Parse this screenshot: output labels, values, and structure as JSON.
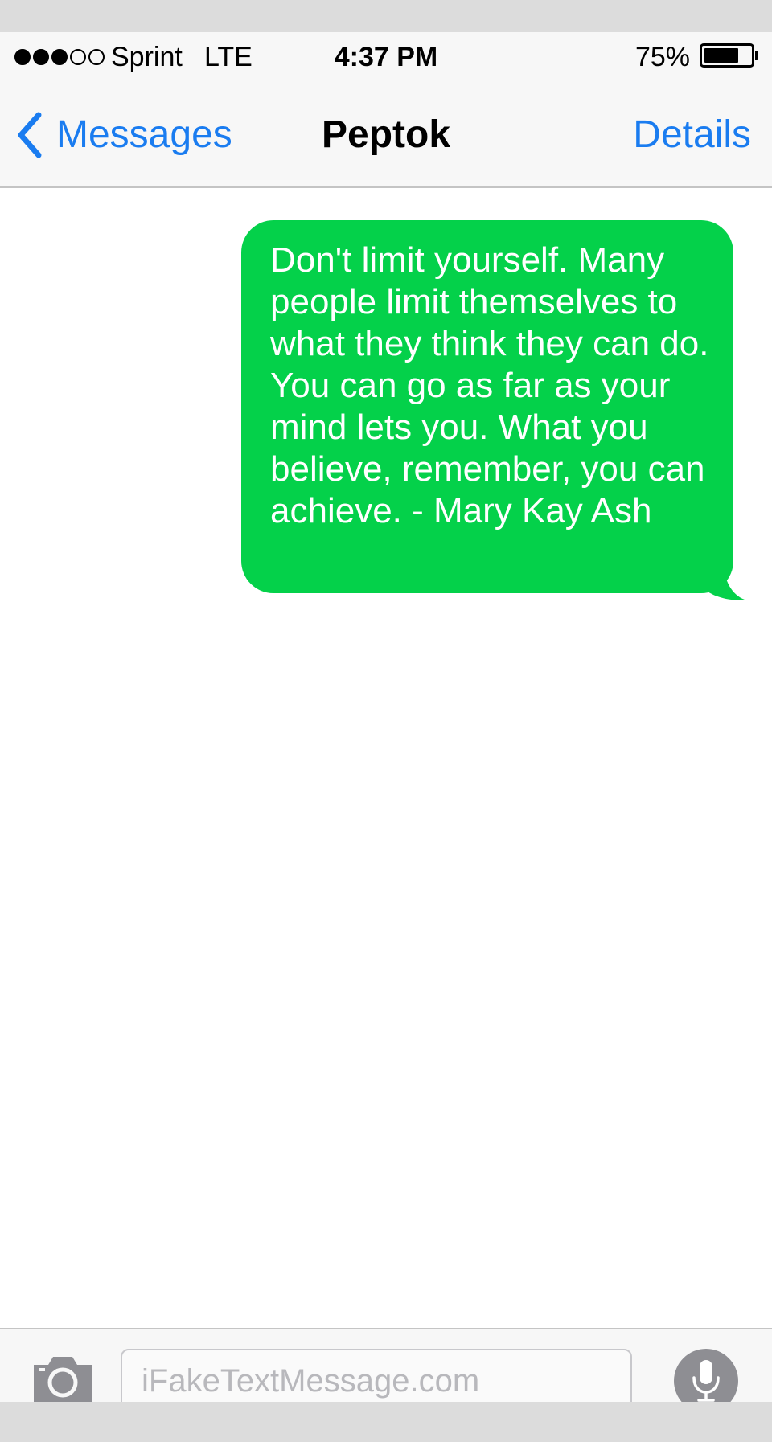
{
  "status_bar": {
    "signal_bars_filled": 3,
    "signal_bars_total": 5,
    "carrier": "Sprint",
    "network": "LTE",
    "time": "4:37 PM",
    "battery_percent_label": "75%",
    "battery_level": 0.75
  },
  "nav": {
    "back_label": "Messages",
    "title": "Peptok",
    "details_label": "Details"
  },
  "messages": [
    {
      "direction": "outgoing",
      "text": "Don't limit yourself. Many people limit themselves to what they think they can do. You can go as far as your mind lets you. What you believe, remember, you can achieve. - Mary Kay Ash"
    }
  ],
  "input_bar": {
    "placeholder": "iFakeTextMessage.com",
    "icons": [
      "camera-icon",
      "microphone-icon"
    ]
  },
  "colors": {
    "accent": "#1a7cf0",
    "bubble_outgoing": "#04d14a",
    "bar_background": "#f7f7f7",
    "mic_button": "#8e8e93",
    "camera_icon": "#8e8e93"
  }
}
